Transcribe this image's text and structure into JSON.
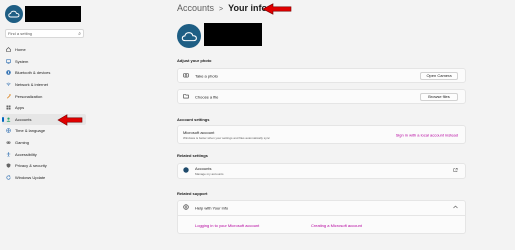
{
  "sidebar": {
    "search_placeholder": "Find a setting",
    "items": [
      {
        "label": "Home",
        "icon": "home-icon"
      },
      {
        "label": "System",
        "icon": "system-icon"
      },
      {
        "label": "Bluetooth & devices",
        "icon": "bluetooth-icon"
      },
      {
        "label": "Network & internet",
        "icon": "network-icon"
      },
      {
        "label": "Personalization",
        "icon": "brush-icon"
      },
      {
        "label": "Apps",
        "icon": "apps-icon"
      },
      {
        "label": "Accounts",
        "icon": "accounts-icon"
      },
      {
        "label": "Time & language",
        "icon": "globe-icon"
      },
      {
        "label": "Gaming",
        "icon": "gaming-icon"
      },
      {
        "label": "Accessibility",
        "icon": "accessibility-icon"
      },
      {
        "label": "Privacy & security",
        "icon": "shield-icon"
      },
      {
        "label": "Windows Update",
        "icon": "update-icon"
      }
    ],
    "active_index": 6
  },
  "breadcrumb": {
    "parent": "Accounts",
    "separator": ">",
    "current": "Your info"
  },
  "photo_section": {
    "title": "Adjust your photo",
    "take_photo_label": "Take a photo",
    "open_camera_label": "Open Camera",
    "choose_file_label": "Choose a file",
    "browse_files_label": "Browse files"
  },
  "account_settings": {
    "title": "Account settings",
    "ms_account_label": "Microsoft account",
    "ms_account_sub": "Windows is better when your settings and files automatically sync",
    "sign_in_local_label": "Sign in with a local account instead"
  },
  "related_settings": {
    "title": "Related settings",
    "accounts_label": "Accounts",
    "accounts_sub": "Manage my accounts"
  },
  "related_support": {
    "title": "Related support",
    "help_label": "Help with Your info",
    "link1": "Logging in to your Microsoft account",
    "link2": "Creating a Microsoft account"
  },
  "colors": {
    "accent": "#0067c0",
    "link": "#b4009e",
    "annotation_arrow": "#e00000"
  }
}
